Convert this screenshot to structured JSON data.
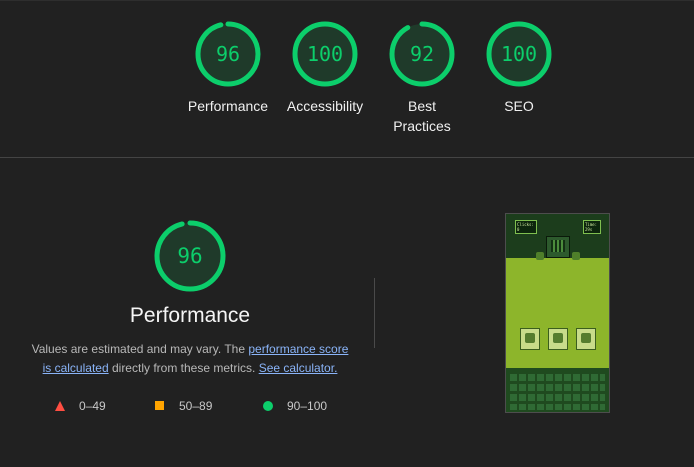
{
  "summary": {
    "gauges": [
      {
        "label": "Performance",
        "score": "96"
      },
      {
        "label": "Accessibility",
        "score": "100"
      },
      {
        "label": "Best Practices",
        "score": "92"
      },
      {
        "label": "SEO",
        "score": "100"
      }
    ]
  },
  "detail": {
    "score": "96",
    "title": "Performance",
    "desc_part1": "Values are estimated and may vary. The ",
    "link_score": "performance score is calculated",
    "desc_part2": " directly from these metrics. ",
    "link_calc": "See calculator."
  },
  "legend": {
    "fail": "0–49",
    "average": "50–89",
    "pass": "90–100"
  },
  "screenshot": {
    "clicks_label": "Clicks:",
    "clicks_value": "0",
    "time_label": "Time:",
    "time_value": "29s"
  },
  "colors": {
    "pass": "#0cce6b",
    "average": "#ffa400",
    "fail": "#ff4e42",
    "background": "#212121",
    "link": "#8ab4f8"
  },
  "icons": [
    "fail-triangle-icon",
    "average-square-icon",
    "pass-circle-icon"
  ]
}
